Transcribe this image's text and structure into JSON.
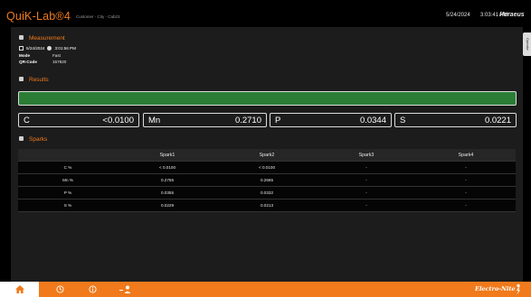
{
  "header": {
    "brand": "QuiK-Lab®4",
    "subtitle": "Customer - City - Cab23",
    "date": "5/24/2024",
    "time": "3:03:41 PM",
    "company": "Heraeus",
    "side_tab": "Operator"
  },
  "measurement": {
    "title": "Measurement",
    "date": "5/24/2024",
    "time": "3:01:56 PM",
    "mode_label": "Mode",
    "mode_value": "Fast",
    "qr_label": "QR-Code",
    "qr_value": "157820"
  },
  "results": {
    "title": "Results",
    "status_color": "#2b7d36",
    "elements": [
      {
        "name": "C",
        "value": "<0.0100"
      },
      {
        "name": "Mn",
        "value": "0.2710"
      },
      {
        "name": "P",
        "value": "0.0344"
      },
      {
        "name": "S",
        "value": "0.0221"
      }
    ]
  },
  "sparks": {
    "title": "Sparks",
    "headers": [
      "",
      "Spark1",
      "Spark2",
      "Spark3",
      "Spark4"
    ],
    "rows": [
      [
        "C %",
        "< 0.0100",
        "< 0.0100",
        "-",
        "-"
      ],
      [
        "Mn %",
        "0.2755",
        "0.2665",
        "-",
        "-"
      ],
      [
        "P %",
        "0.0355",
        "0.0332",
        "-",
        "-"
      ],
      [
        "S %",
        "0.0229",
        "0.0213",
        "-",
        "-"
      ]
    ]
  },
  "footer": {
    "logo": "Electro-Nite",
    "nav": [
      {
        "icon": "home-icon"
      },
      {
        "icon": "history-icon"
      },
      {
        "icon": "info-icon"
      },
      {
        "icon": "user-icon"
      }
    ],
    "accent": "#f07a1c"
  }
}
